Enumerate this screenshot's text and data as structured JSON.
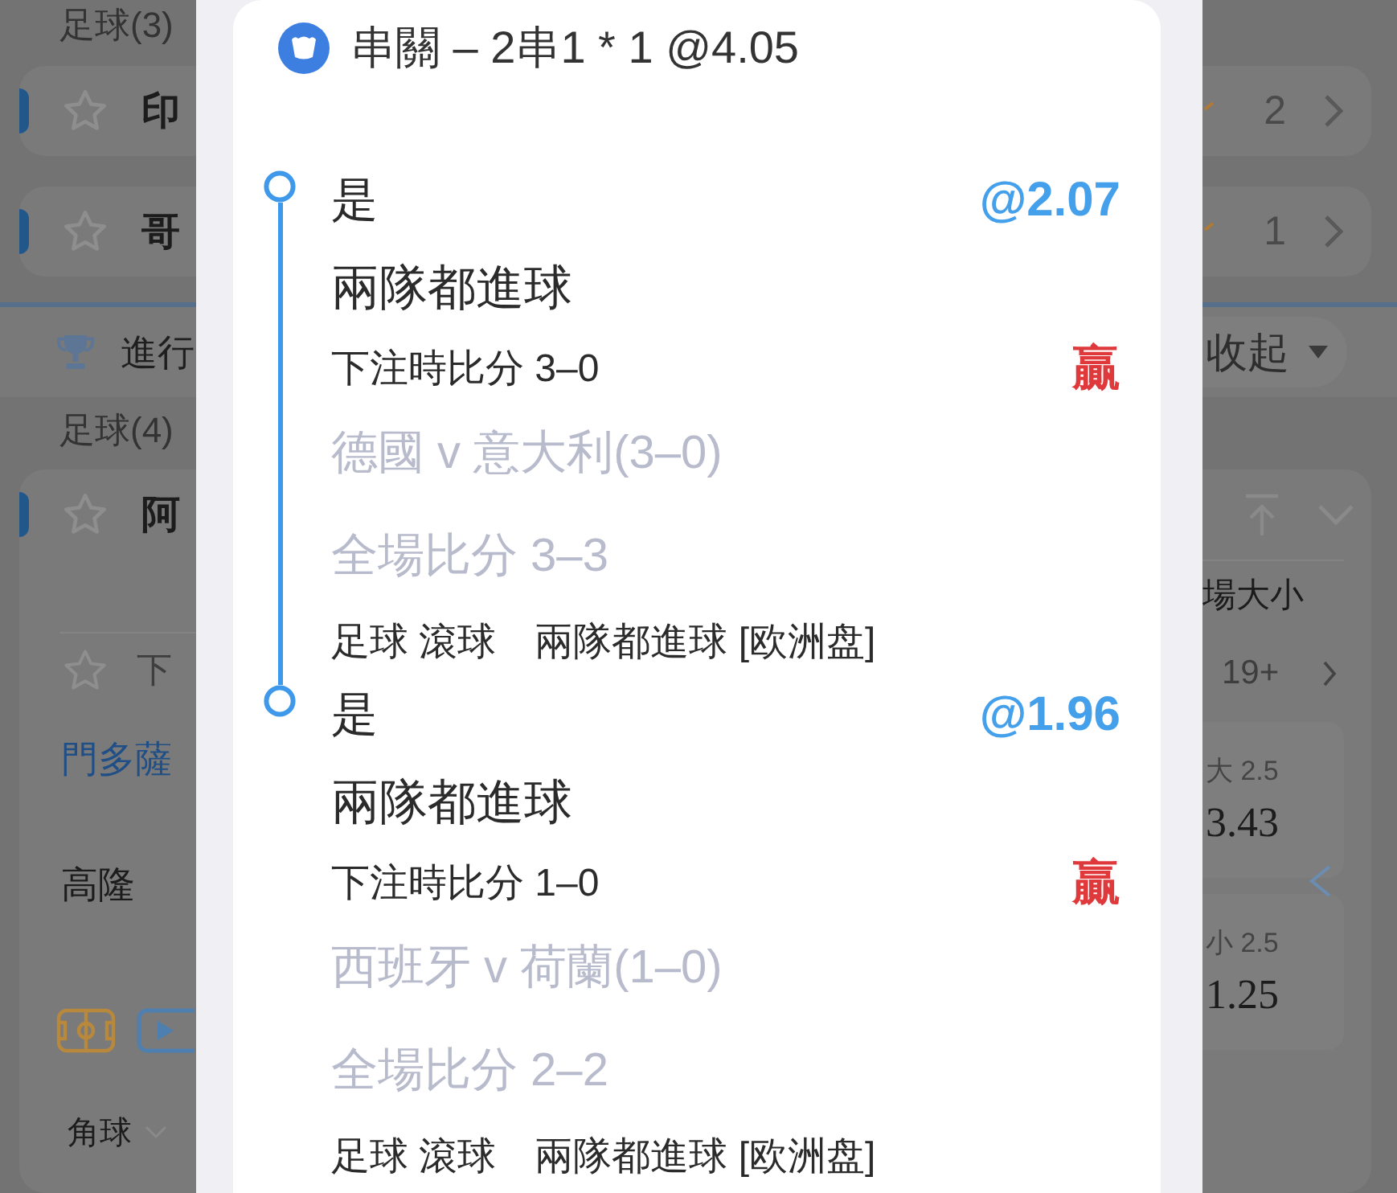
{
  "background": {
    "upcoming_section": {
      "label": "足球(3)",
      "matches": [
        {
          "team": "印",
          "count": "2"
        },
        {
          "team": "哥",
          "count": "1"
        }
      ]
    },
    "live_bar": {
      "label": "進行",
      "collapse_button": "收起"
    },
    "live_section": {
      "label": "足球(4)",
      "match": {
        "team": "阿",
        "market_header": "場大小",
        "period": {
          "label": "下",
          "count": "19+"
        },
        "home_team": "門多薩",
        "away_team": "高隆",
        "odds": [
          {
            "label": "大 2.5",
            "value": "3.43"
          },
          {
            "label": "小 2.5",
            "value": "1.25"
          }
        ],
        "filter": "角球"
      }
    }
  },
  "parlay_slip": {
    "title": "串關 – 2串1 * 1 @4.05",
    "legs": [
      {
        "selection": "是",
        "odds": "@2.07",
        "market": "兩隊都進球",
        "score_at_bet": "下注時比分 3–0",
        "result": "贏",
        "match": "德國 v 意大利(3–0)",
        "full_time_score": "全場比分 3–3",
        "sport": "足球 滾球",
        "market_tag": "兩隊都進球 [欧洲盘]"
      },
      {
        "selection": "是",
        "odds": "@1.96",
        "market": "兩隊都進球",
        "score_at_bet": "下注時比分 1–0",
        "result": "贏",
        "match": "西班牙 v 荷蘭(1–0)",
        "full_time_score": "全場比分 2–2",
        "sport": "足球 滾球",
        "market_tag": "兩隊都進球 [欧洲盘]"
      }
    ]
  }
}
